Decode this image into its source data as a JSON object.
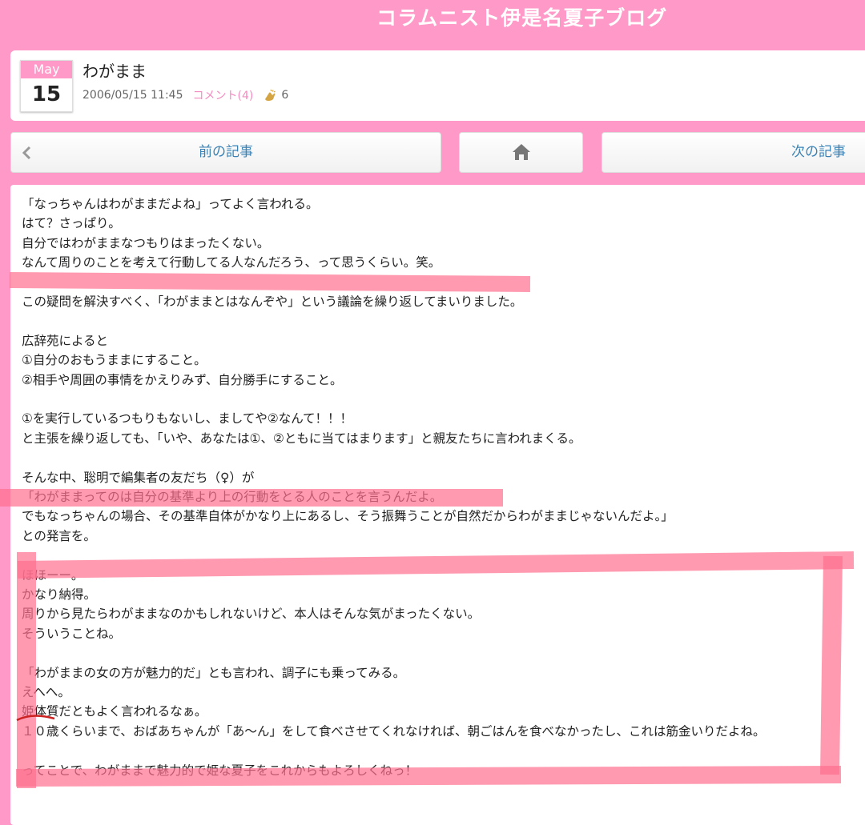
{
  "site": {
    "title": "コラムニスト伊是名夏子ブログ"
  },
  "post": {
    "month": "May",
    "day": "15",
    "title": "わがまま",
    "datetime": "2006/05/15 11:45",
    "comments": "コメント(4)",
    "claps": "6"
  },
  "nav": {
    "prev": "前の記事",
    "next": "次の記事"
  },
  "body": [
    "「なっちゃんはわがままだよね」ってよく言われる。",
    "はて？さっぱり。",
    "自分ではわがままなつもりはまったくない。",
    "なんて周りのことを考えて行動してる人なんだろう、って思うくらい。笑。",
    "",
    "この疑問を解決すべく、「わがままとはなんぞや」という議論を繰り返してまいりました。",
    "",
    "広辞苑によると",
    "①自分のおもうままにすること。",
    "②相手や周囲の事情をかえりみず、自分勝手にすること。",
    "",
    "①を実行しているつもりもないし、ましてや②なんて！！！",
    "と主張を繰り返しても、「いや、あなたは①、②ともに当てはまります」と親友たちに言われまくる。",
    "",
    "そんな中、聡明で編集者の友だち（♀）が",
    "「わがままってのは自分の基準より上の行動をとる人のことを言うんだよ。",
    "でもなっちゃんの場合、その基準自体がかなり上にあるし、そう振舞うことが自然だからわがままじゃないんだよ。」",
    "との発言を。",
    "",
    "ほほーー。",
    "かなり納得。",
    "周りから見たらわがままなのかもしれないけど、本人はそんな気がまったくない。",
    "そういうことね。",
    "",
    "「わがままの女の方が魅力的だ」とも言われ、調子にも乗ってみる。",
    "えへへ。",
    "姫体質だともよく言われるなぁ。",
    "１０歳くらいまで、おばあちゃんが「あ～ん」をして食べさせてくれなければ、朝ごはんを食べなかったし、これは筋金いりだよね。",
    "",
    "ってことで、わがままで魅力的で姫な夏子をこれからもよろしくねっ！"
  ],
  "colors": {
    "brand_pink": "#ff99c8",
    "link_blue": "#3a82b5",
    "marker": "#ff6f8f"
  }
}
